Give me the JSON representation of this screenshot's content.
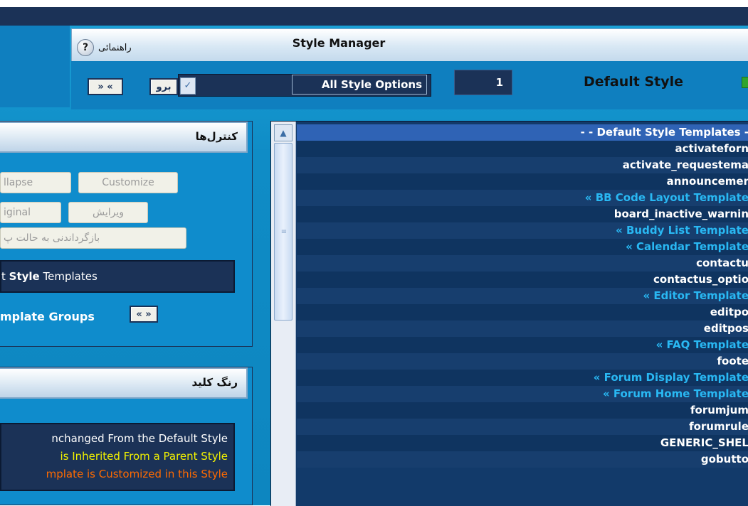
{
  "header": {
    "title": "Style Manager",
    "help_label": "راهنمائی",
    "help_icon": "?"
  },
  "toolbar": {
    "expand_button": "» «",
    "go_button": "برو",
    "select_value": "All Style Options",
    "page_number": "1",
    "style_name": "Default Style"
  },
  "controls_panel": {
    "heading": "کنترل‌ها",
    "collapse_button": "llapse",
    "customize_button": "Customize",
    "original_button": "iginal",
    "edit_button": "ویرایش",
    "revert_button": "بازگرداندنی به حالت پ",
    "templates_prefix": "t ",
    "templates_bold": "Style",
    "templates_suffix": " Templates",
    "template_groups": "mplate Groups",
    "template_groups_button": "« »"
  },
  "color_key": {
    "heading": "رنگ کلید",
    "lines": [
      {
        "text": "nchanged From the Default Style",
        "color": "#ffffff"
      },
      {
        "text": "is Inherited From a Parent Style",
        "color": "#f2f200"
      },
      {
        "text": "mplate is Customized in this Style",
        "color": "#ff6a00"
      }
    ]
  },
  "template_list": [
    {
      "text": "- - Default Style Templates -",
      "kind": "selected"
    },
    {
      "text": "activateforn",
      "kind": "item"
    },
    {
      "text": "activate_requestema",
      "kind": "item"
    },
    {
      "text": "announcemer",
      "kind": "item"
    },
    {
      "text": "« BB Code Layout Template",
      "kind": "group"
    },
    {
      "text": "board_inactive_warnin",
      "kind": "item"
    },
    {
      "text": "« Buddy List Template",
      "kind": "group"
    },
    {
      "text": "« Calendar Template",
      "kind": "group"
    },
    {
      "text": "contactu",
      "kind": "item"
    },
    {
      "text": "contactus_optio",
      "kind": "item"
    },
    {
      "text": "« Editor Template",
      "kind": "group"
    },
    {
      "text": "editpo",
      "kind": "item"
    },
    {
      "text": "editpos",
      "kind": "item"
    },
    {
      "text": "« FAQ Template",
      "kind": "group"
    },
    {
      "text": "foote",
      "kind": "item"
    },
    {
      "text": "« Forum Display Template",
      "kind": "group"
    },
    {
      "text": "« Forum Home Template",
      "kind": "group"
    },
    {
      "text": "forumjum",
      "kind": "item"
    },
    {
      "text": "forumrule",
      "kind": "item"
    },
    {
      "text": "GENERIC_SHEL",
      "kind": "item"
    },
    {
      "text": "gobutto",
      "kind": "item"
    }
  ],
  "colors": {
    "navy": "#1b3257",
    "page_blue": "#0f8ccc",
    "group_text": "#29b8f3",
    "selected_row": "#2f63b5"
  }
}
